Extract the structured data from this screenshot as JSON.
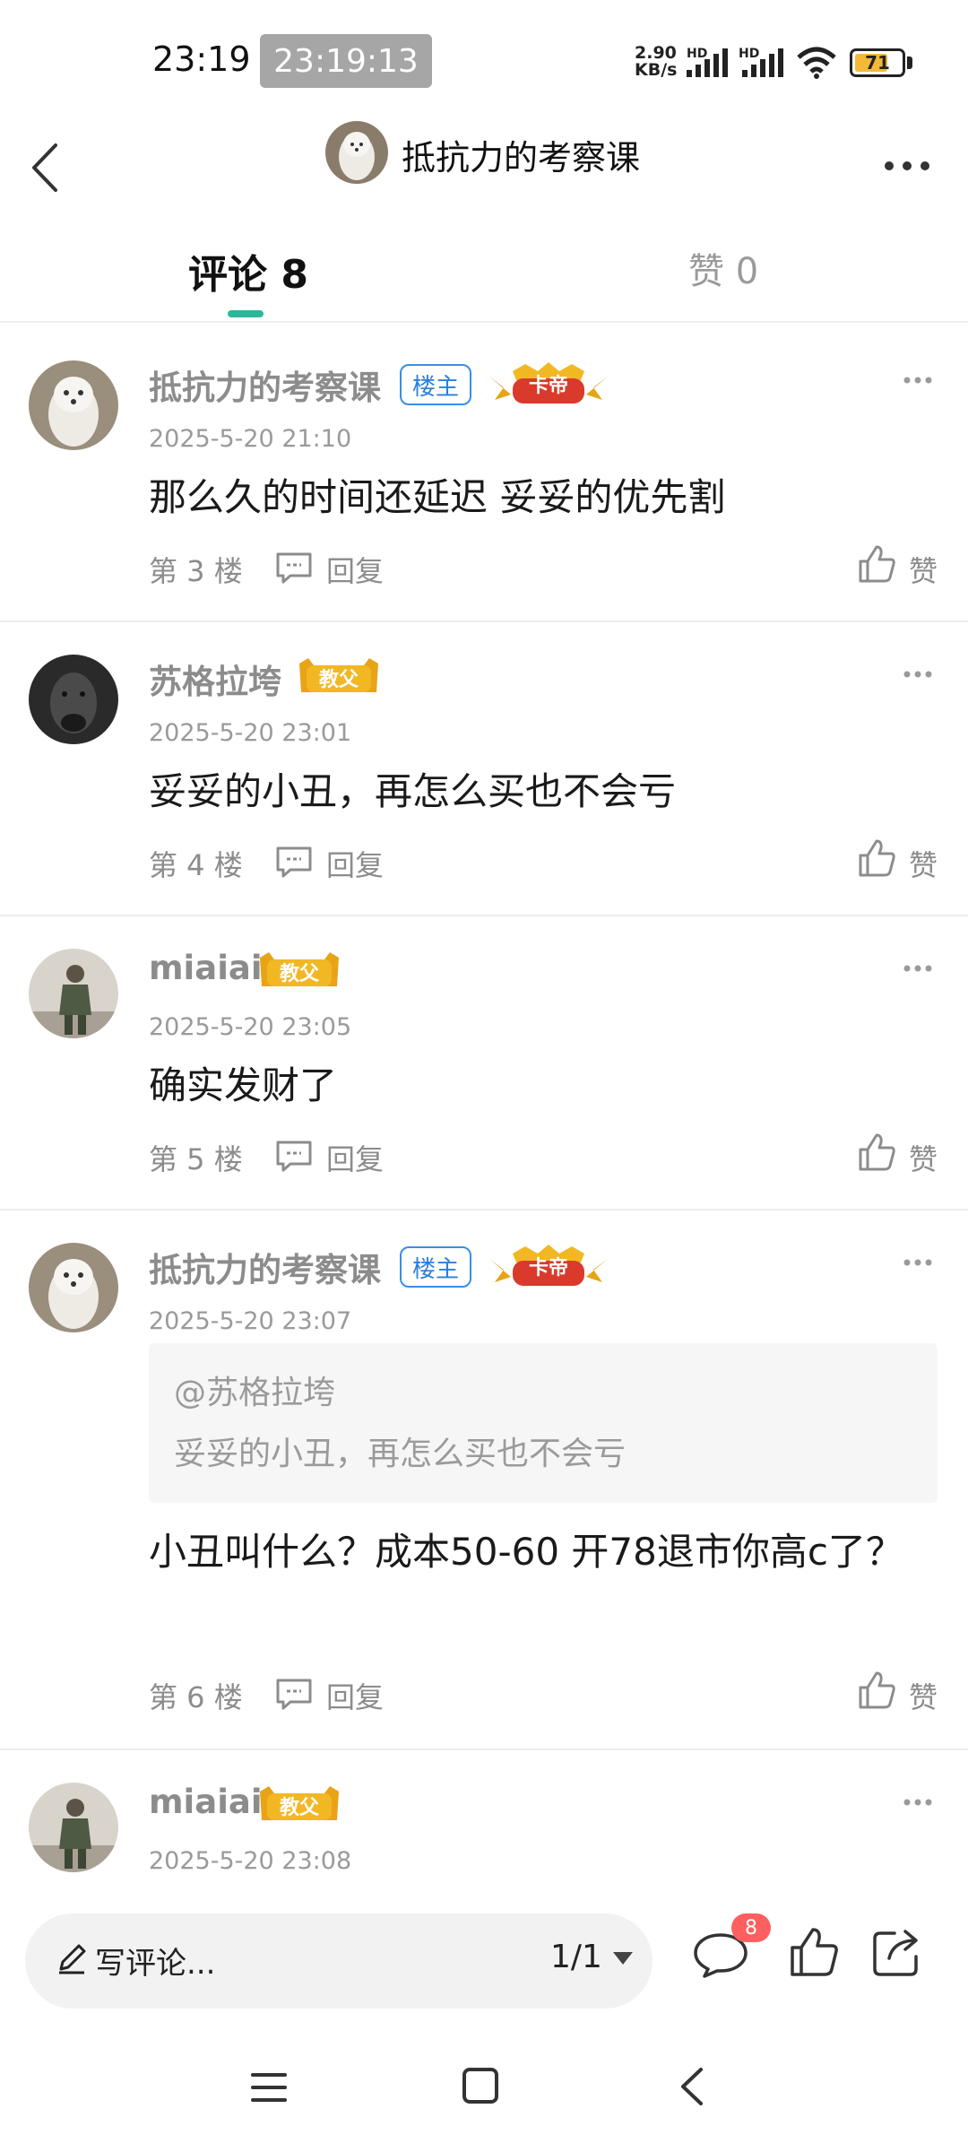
{
  "status_bar": {
    "time": "23:19",
    "time_overlay": "23:19:13",
    "net_speed_value": "2.90",
    "net_speed_unit": "KB/s",
    "hd_label_1": "HD",
    "hd_label_2": "HD",
    "battery": "71"
  },
  "header": {
    "title": "抵抗力的考察课"
  },
  "tabs": {
    "comments": "评论 8",
    "likes": "赞 0"
  },
  "comments": [
    {
      "name": "抵抗力的考察课",
      "host_badge": "楼主",
      "medal": "卡帝",
      "time": "2025-5-20 21:10",
      "text": "那么久的时间还延迟  妥妥的优先割",
      "floor": "第 3 楼",
      "reply": "回复",
      "like": "赞"
    },
    {
      "name": "苏格拉垮",
      "medal": "教父",
      "time": "2025-5-20 23:01",
      "text": "妥妥的小丑，再怎么买也不会亏",
      "floor": "第 4 楼",
      "reply": "回复",
      "like": "赞"
    },
    {
      "name": "miaiai",
      "medal": "教父",
      "time": "2025-5-20 23:05",
      "text": "确实发财了",
      "floor": "第 5 楼",
      "reply": "回复",
      "like": "赞"
    },
    {
      "name": "抵抗力的考察课",
      "host_badge": "楼主",
      "medal": "卡帝",
      "time": "2025-5-20 23:07",
      "quote_user": "@苏格拉垮",
      "quote_text": "妥妥的小丑，再怎么买也不会亏",
      "text": "小丑叫什么？成本50-60  开78退市你高c了？",
      "floor": "第 6 楼",
      "reply": "回复",
      "like": "赞"
    },
    {
      "name": "miaiai",
      "medal": "教父",
      "time": "2025-5-20 23:08"
    }
  ],
  "bottom_bar": {
    "write_placeholder": "写评论...",
    "page_indicator": "1/1",
    "comment_count": "8"
  },
  "colors": {
    "accent": "#2bb89a",
    "host_badge": "#2a7fdc",
    "medal_gold": "#e8a317",
    "medal_red": "#d93a2b",
    "badge_red": "#ff5f5f"
  }
}
